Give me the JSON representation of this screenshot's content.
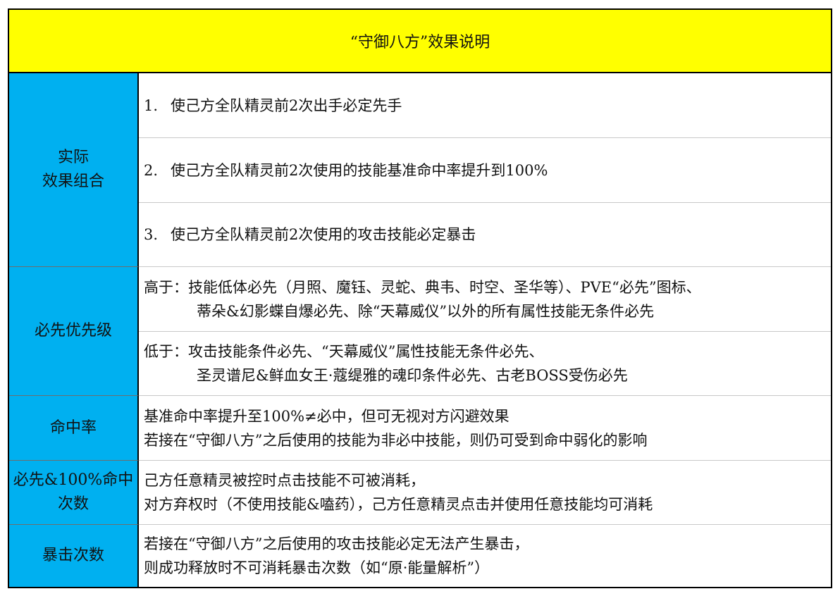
{
  "title": "“守御八方”效果说明",
  "rows": {
    "effects": {
      "label_line1": "实际",
      "label_line2": "效果组合",
      "items": [
        {
          "num": "1.",
          "text": "使己方全队精灵前2次出手必定先手"
        },
        {
          "num": "2.",
          "text": "使己方全队精灵前2次使用的技能基准命中率提升到100%"
        },
        {
          "num": "3.",
          "text": "使己方全队精灵前2次使用的攻击技能必定暴击"
        }
      ]
    },
    "priority": {
      "label": "必先优先级",
      "higher_line1": "高于：技能低体必先（月照、魔钰、灵蛇、典韦、时空、圣华等）、PVE“必先”图标、",
      "higher_line2": "蒂朵&幻影蝶自爆必先、除“天幕威仪”以外的所有属性技能无条件必先",
      "lower_line1": "低于：攻击技能条件必先、“天幕威仪”属性技能无条件必先、",
      "lower_line2": "圣灵谱尼&鲜血女王·蔻缇雅的魂印条件必先、古老BOSS受伤必先"
    },
    "accuracy": {
      "label": "命中率",
      "line1": "基准命中率提升至100%≠必中，但可无视对方闪避效果",
      "line2": "若接在“守御八方”之后使用的技能为非必中技能，则仍可受到命中弱化的影响"
    },
    "count": {
      "label_line1": "必先&100%命中",
      "label_line2": "次数",
      "line1": "己方任意精灵被控时点击技能不可被消耗，",
      "line2": "对方弃权时（不使用技能&嗑药），己方任意精灵点击并使用任意技能均可消耗"
    },
    "crit": {
      "label": "暴击次数",
      "line1": "若接在“守御八方”之后使用的攻击技能必定无法产生暴击，",
      "line2": "则成功释放时不可消耗暴击次数（如“原·能量解析”）"
    }
  },
  "colors": {
    "title_bg": "#ffff00",
    "label_bg": "#00b0f0"
  }
}
